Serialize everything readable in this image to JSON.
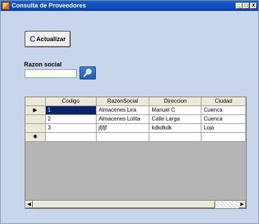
{
  "window": {
    "title": "Consulta de Proveedores",
    "controls": {
      "minimize": "_",
      "maximize": "□",
      "close": "X"
    }
  },
  "toolbar": {
    "refresh_label": "Actualizar",
    "refresh_icon": "refresh-icon"
  },
  "search": {
    "label": "Razon social",
    "value": "",
    "button_icon": "search-icon"
  },
  "grid": {
    "columns": [
      "Codigo",
      "RazonSocial",
      "Direccion",
      "Ciudad"
    ],
    "rows": [
      {
        "indicator": "▶",
        "cells": [
          "1",
          "Almacenes Lira",
          "Manuel C",
          "Cuenca"
        ]
      },
      {
        "indicator": "",
        "cells": [
          "2",
          "Almacenes Lolita",
          "Calle Larga",
          "Cuenca"
        ]
      },
      {
        "indicator": "",
        "cells": [
          "3",
          "jfjfjf",
          "kdkdkdk",
          "Loja"
        ]
      }
    ],
    "new_row_indicator": "✱",
    "selected_cell": {
      "row": 0,
      "column": 0
    }
  },
  "scrollbar": {
    "left_arrow": "◀",
    "right_arrow": "▶"
  },
  "colors": {
    "form_background": "#c8d5ea",
    "titlebar": "#1a5fcf",
    "selection": "#0a246a",
    "search_button": "#2a6fc8"
  }
}
